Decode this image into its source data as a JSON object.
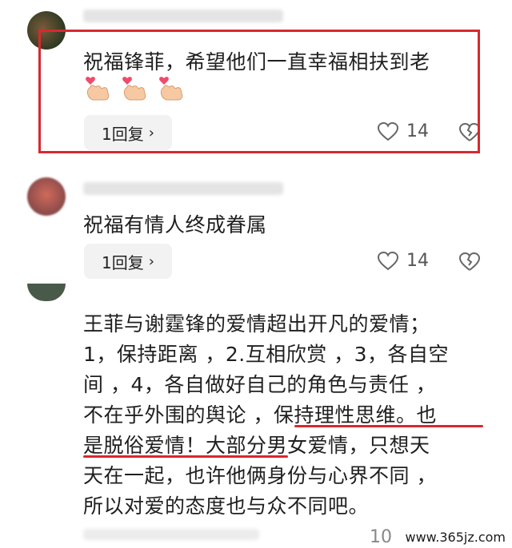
{
  "comments": [
    {
      "text": "祝福锋菲，希望他们一直幸福相扶到老",
      "reply_label": "1回复",
      "like_count": "14",
      "emoji": "finger-heart-emoji"
    },
    {
      "text": "祝福有情人终成眷属",
      "reply_label": "1回复",
      "like_count": "14"
    },
    {
      "lines": [
        "王菲与谢霆锋的爱情超出开凡的爱情；",
        "1，保持距离 ，2.互相欣赏 ，3，各自空",
        "间 ，4，各自做好自己的角色与责任 ，",
        "不在乎外围的舆论 ，保持理性思维。也",
        "是脱俗爱情！大部分男女爱情，只想天",
        "天在一起，也许他俩身份与心界不同 ，",
        "所以对爱的态度也与众不同吧。"
      ],
      "like_count_partial": "10"
    }
  ],
  "watermark": "www.365jz.com",
  "colors": {
    "highlight": "#d9282f",
    "reply_bg": "#f2f2f2"
  }
}
